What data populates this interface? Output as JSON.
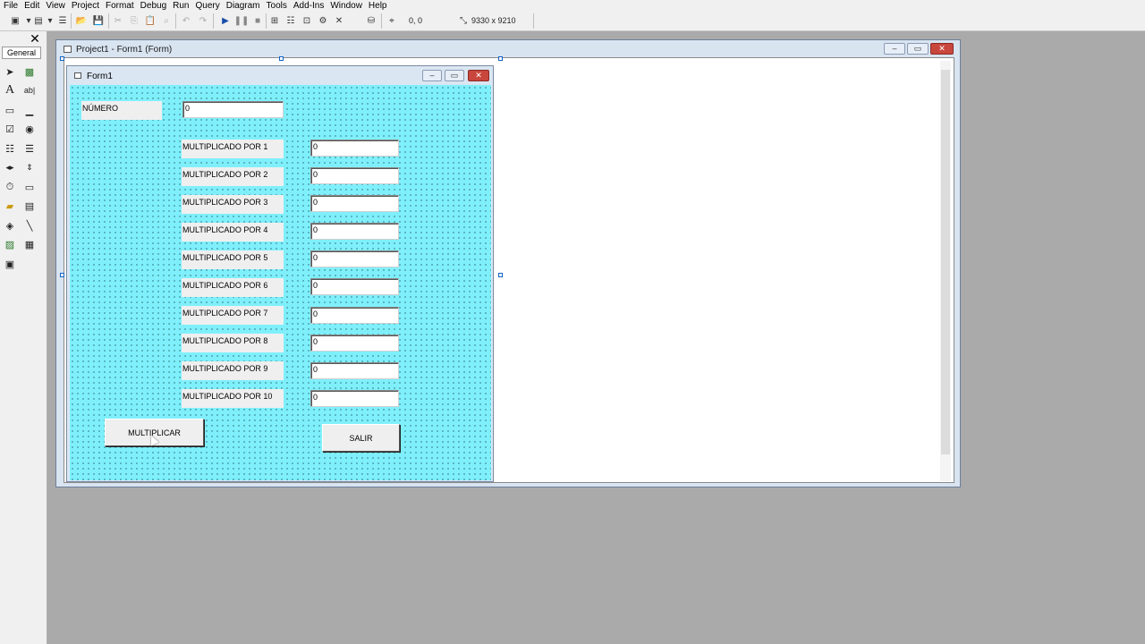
{
  "menu": [
    "File",
    "Edit",
    "View",
    "Project",
    "Format",
    "Debug",
    "Run",
    "Query",
    "Diagram",
    "Tools",
    "Add-Ins",
    "Window",
    "Help"
  ],
  "toolbar": {
    "position": "0, 0",
    "size": "9330 x 9210"
  },
  "toolbox": {
    "tab_label": "General"
  },
  "project_window": {
    "title": "Project1 - Form1 (Form)"
  },
  "form": {
    "title": "Form1",
    "numero_label": "NÚMERO",
    "numero_value": "0",
    "rows": [
      {
        "label": "MULTIPLICADO POR 1",
        "value": "0"
      },
      {
        "label": "MULTIPLICADO POR 2",
        "value": "0"
      },
      {
        "label": "MULTIPLICADO POR 3",
        "value": "0"
      },
      {
        "label": "MULTIPLICADO POR 4",
        "value": "0"
      },
      {
        "label": "MULTIPLICADO POR 5",
        "value": "0"
      },
      {
        "label": "MULTIPLICADO POR 6",
        "value": "0"
      },
      {
        "label": "MULTIPLICADO POR 7",
        "value": "0"
      },
      {
        "label": "MULTIPLICADO POR 8",
        "value": "0"
      },
      {
        "label": "MULTIPLICADO POR 9",
        "value": "0"
      },
      {
        "label": "MULTIPLICADO POR 10",
        "value": "0"
      }
    ],
    "multiplicar_label": "MULTIPLICAR",
    "salir_label": "SALIR"
  }
}
